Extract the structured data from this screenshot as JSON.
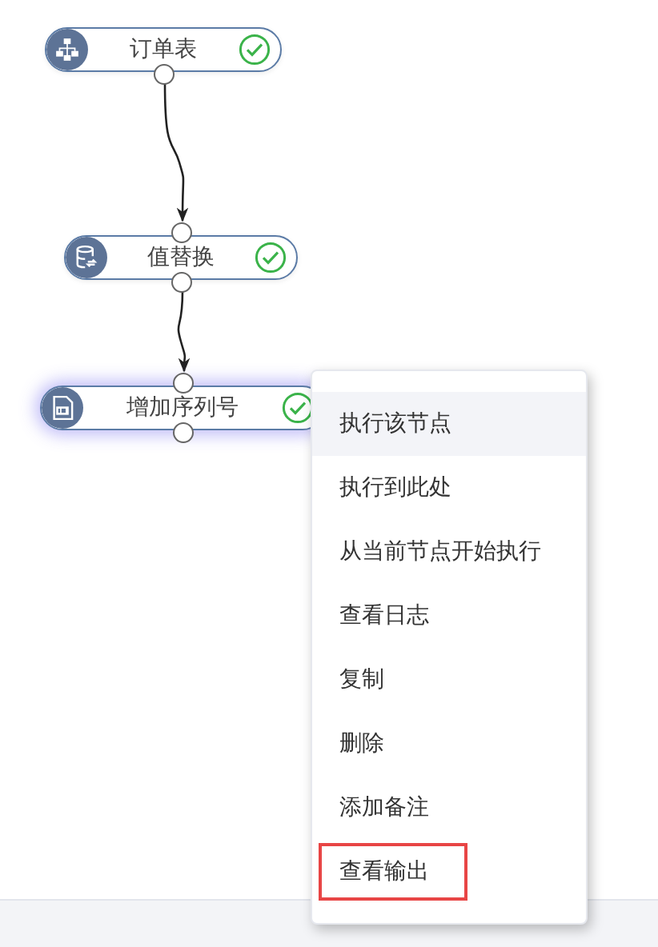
{
  "nodes": [
    {
      "label": "订单表",
      "kind": "table",
      "done": true,
      "selected": false
    },
    {
      "label": "值替换",
      "kind": "database",
      "done": true,
      "selected": false
    },
    {
      "label": "增加序列号",
      "kind": "id",
      "done": true,
      "selected": true
    }
  ],
  "context_menu": {
    "items": [
      {
        "label": "执行该节点",
        "highlighted": true,
        "annotated": false
      },
      {
        "label": "执行到此处",
        "highlighted": false,
        "annotated": false
      },
      {
        "label": "从当前节点开始执行",
        "highlighted": false,
        "annotated": false
      },
      {
        "label": "查看日志",
        "highlighted": false,
        "annotated": false
      },
      {
        "label": "复制",
        "highlighted": false,
        "annotated": false
      },
      {
        "label": "删除",
        "highlighted": false,
        "annotated": false
      },
      {
        "label": "添加备注",
        "highlighted": false,
        "annotated": false
      },
      {
        "label": "查看输出",
        "highlighted": false,
        "annotated": true
      }
    ]
  }
}
